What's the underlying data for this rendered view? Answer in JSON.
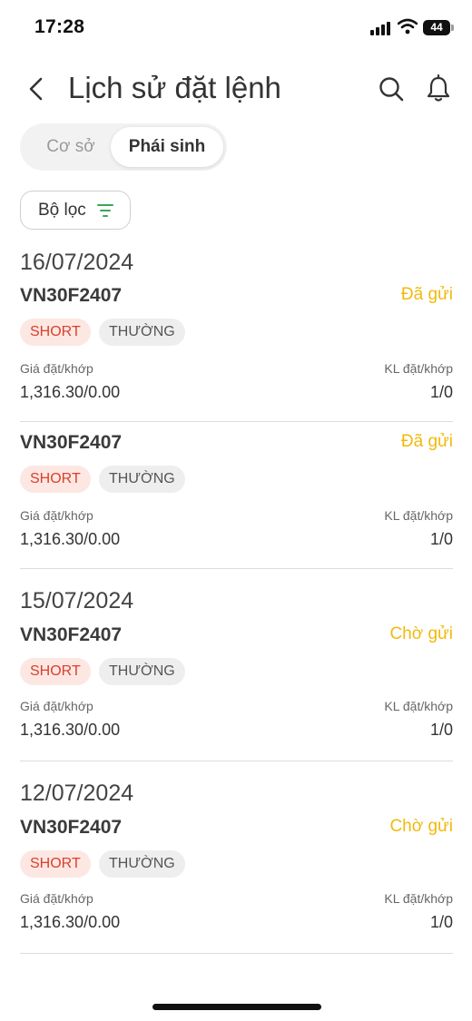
{
  "status_bar": {
    "time": "17:28",
    "battery": "44"
  },
  "header": {
    "title": "Lịch sử đặt lệnh"
  },
  "tabs": [
    {
      "label": "Cơ sở",
      "active": false
    },
    {
      "label": "Phái sinh",
      "active": true
    }
  ],
  "filter": {
    "label": "Bộ lọc"
  },
  "groups": [
    {
      "date": "16/07/2024",
      "orders": [
        {
          "symbol": "VN30F2407",
          "status": "Đã gửi",
          "side": "SHORT",
          "type": "THƯỜNG",
          "price_label": "Giá đặt/khớp",
          "price": "1,316.30/0.00",
          "qty_label": "KL đặt/khớp",
          "qty": "1/0"
        },
        {
          "symbol": "VN30F2407",
          "status": "Đã gửi",
          "side": "SHORT",
          "type": "THƯỜNG",
          "price_label": "Giá đặt/khớp",
          "price": "1,316.30/0.00",
          "qty_label": "KL đặt/khớp",
          "qty": "1/0"
        }
      ]
    },
    {
      "date": "15/07/2024",
      "orders": [
        {
          "symbol": "VN30F2407",
          "status": "Chờ gửi",
          "side": "SHORT",
          "type": "THƯỜNG",
          "price_label": "Giá đặt/khớp",
          "price": "1,316.30/0.00",
          "qty_label": "KL đặt/khớp",
          "qty": "1/0"
        }
      ]
    },
    {
      "date": "12/07/2024",
      "orders": [
        {
          "symbol": "VN30F2407",
          "status": "Chờ gửi",
          "side": "SHORT",
          "type": "THƯỜNG",
          "price_label": "Giá đặt/khớp",
          "price": "1,316.30/0.00",
          "qty_label": "KL đặt/khớp",
          "qty": "1/0"
        }
      ]
    }
  ],
  "colors": {
    "status": "#f2b90c",
    "short_text": "#d9402b",
    "short_bg": "#fde7e3",
    "filter_icon": "#3aa657"
  }
}
